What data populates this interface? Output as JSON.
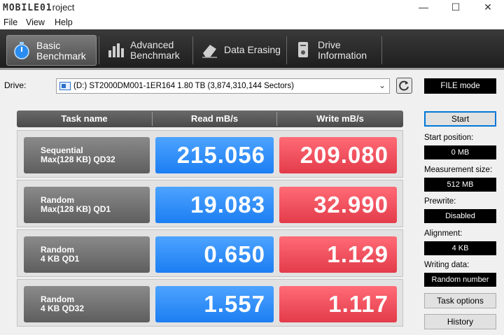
{
  "window": {
    "title_logo": "MOBILE01",
    "title_rest": "roject",
    "minimize": "—",
    "maximize": "☐",
    "close": "✕"
  },
  "menu": [
    "File",
    "View",
    "Help"
  ],
  "toolbar": {
    "tabs": [
      {
        "line1": "Basic",
        "line2": "Benchmark",
        "icon": "stopwatch-icon",
        "active": true
      },
      {
        "line1": "Advanced",
        "line2": "Benchmark",
        "icon": "bar-chart-icon",
        "active": false
      },
      {
        "line1": "Data Erasing",
        "line2": "",
        "icon": "eraser-icon",
        "active": false
      },
      {
        "line1": "Drive",
        "line2": "Information",
        "icon": "drive-info-icon",
        "active": false
      }
    ]
  },
  "drive": {
    "label": "Drive:",
    "selected": "(D:) ST2000DM001-1ER164  1.80 TB (3,874,310,144 Sectors)",
    "mode": "FILE mode"
  },
  "table": {
    "headers": [
      "Task name",
      "Read mB/s",
      "Write mB/s"
    ],
    "rows": [
      {
        "line1": "Sequential",
        "line2": "Max(128 KB) QD32",
        "read": "215.056",
        "write": "209.080"
      },
      {
        "line1": "Random",
        "line2": "Max(128 KB) QD1",
        "read": "19.083",
        "write": "32.990"
      },
      {
        "line1": "Random",
        "line2": "4 KB QD1",
        "read": "0.650",
        "write": "1.129"
      },
      {
        "line1": "Random",
        "line2": "4 KB QD32",
        "read": "1.557",
        "write": "1.117"
      }
    ]
  },
  "panel": {
    "start": "Start",
    "start_position_label": "Start position:",
    "start_position": "0 MB",
    "measurement_size_label": "Measurement size:",
    "measurement_size": "512 MB",
    "prewrite_label": "Prewrite:",
    "prewrite": "Disabled",
    "alignment_label": "Alignment:",
    "alignment": "4 KB",
    "writing_data_label": "Writing data:",
    "writing_data": "Random number",
    "task_options": "Task options",
    "history": "History"
  },
  "colors": {
    "read": "#1c7ef2",
    "write": "#e33b4a",
    "toolbar": "#2a2a2a"
  }
}
